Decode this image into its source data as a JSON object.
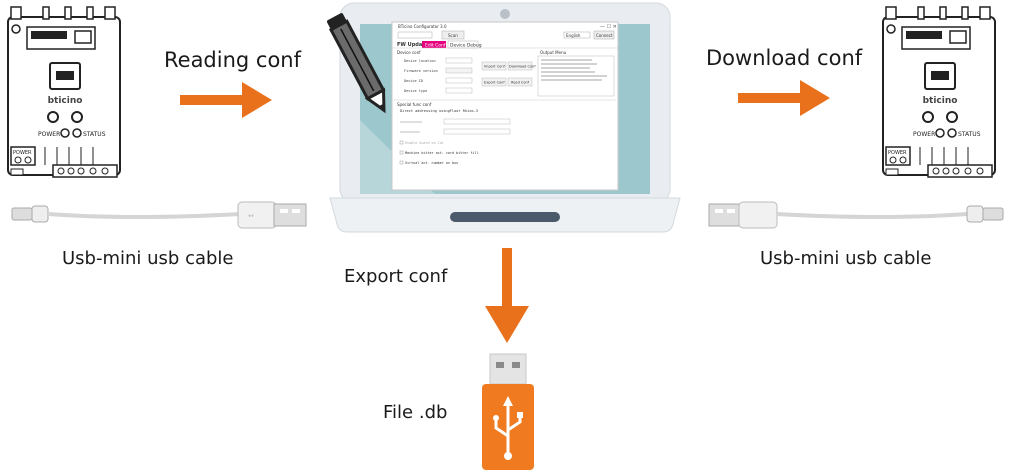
{
  "labels": {
    "reading": "Reading conf",
    "download": "Download conf",
    "export": "Export conf",
    "cable_left": "Usb-mini usb cable",
    "cable_right": "Usb-mini usb cable",
    "file": "File .db"
  },
  "device": {
    "brand": "bticino",
    "power": "POWER",
    "status": "STATUS",
    "power_conn": "POWER"
  },
  "app": {
    "window_title": "BTicino Configurator 3.0",
    "search_button": "Scan",
    "lang": "English",
    "connect_button": "Connect",
    "tabs": [
      "FW Update",
      "Edit Conf",
      "Device Debug"
    ],
    "device_conf_header": "Device conf",
    "rows": [
      "Device location",
      "Firmware version",
      "Device ID",
      "Device type"
    ],
    "buttons": [
      "Import Conf",
      "Download Conf",
      "Export Conf",
      "Read Conf"
    ],
    "output_header": "Output Menu",
    "special_header": "Special func conf",
    "special_sub": "Direct addressing usingFloor Rhizo-3",
    "checks": [
      "Enable Guard on Cat",
      "Machine bitter act. cord bitter fill",
      "Virtual act. number on bus"
    ]
  },
  "colors": {
    "accent": "#e9711c",
    "tab_active": "#e6007e",
    "screen": "#9cc7cd",
    "laptop": "#e9edf1",
    "usb_orange": "#f07a1f"
  },
  "icons": [
    "arrow-right-icon",
    "arrow-down-icon",
    "pen-icon",
    "usb-symbol-icon"
  ]
}
